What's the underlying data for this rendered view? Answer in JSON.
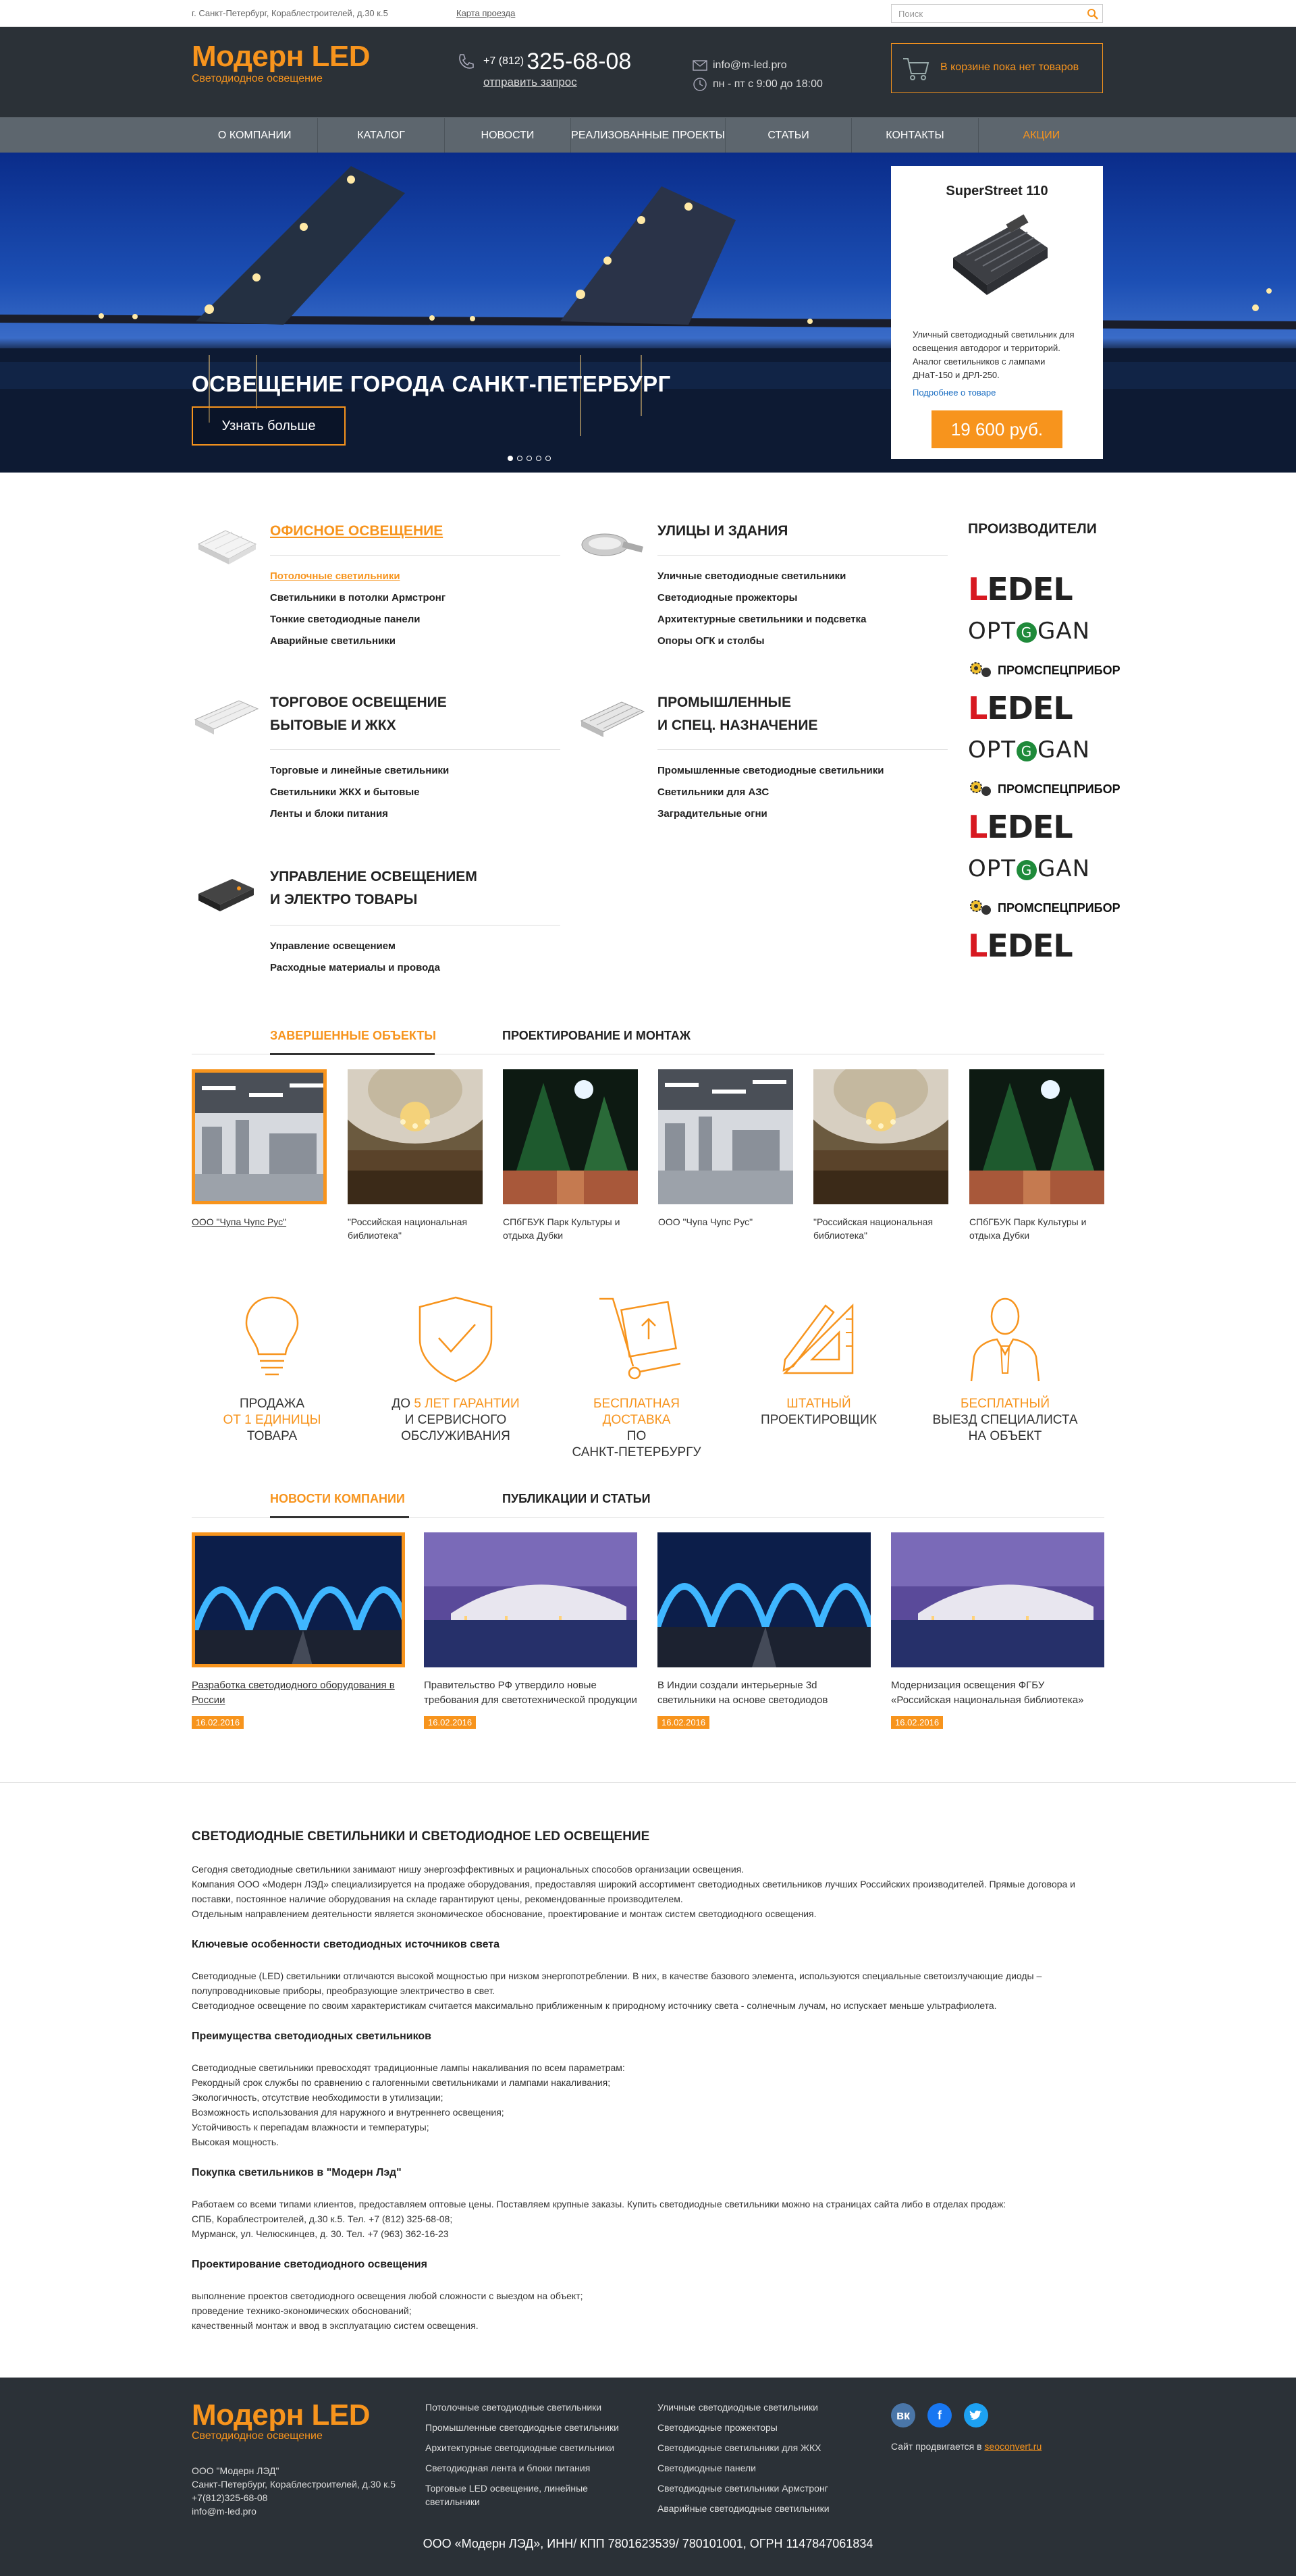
{
  "topbar": {
    "address": "г. Санкт-Петербург, Кораблестроителей, д.30 к.5",
    "map_link": "Карта проезда",
    "search_placeholder": "Поиск"
  },
  "brand": {
    "name": "Модерн LED",
    "tagline": "Светодиодное освещение"
  },
  "header": {
    "phone_code": "+7 (812)",
    "phone_number": "325-68-08",
    "request_link": "отправить запрос",
    "email": "info@m-led.pro",
    "hours": "пн - пт с 9:00 до 18:00",
    "cart_text": "В корзине пока нет товаров"
  },
  "nav": [
    "О КОМПАНИИ",
    "КАТАЛОГ",
    "НОВОСТИ",
    "РЕАЛИЗОВАННЫЕ ПРОЕКТЫ",
    "СТАТЬИ",
    "КОНТАКТЫ",
    "АКЦИИ"
  ],
  "hero": {
    "title": "ОСВЕЩЕНИЕ ГОРОДА САНКТ-ПЕТЕРБУРГ",
    "button": "Узнать больше",
    "slides": 5,
    "active_slide": 1
  },
  "promo": {
    "title": "SuperStreet 110",
    "description": "Уличный светодиодный светильник для освещения автодорог и территорий. Аналог светильников с лампами ДНаТ-150 и ДРЛ-250.",
    "more": "Подробнее о товаре",
    "price": "19 600 руб."
  },
  "categories": [
    {
      "title": [
        "ОФИСНОЕ ОСВЕЩЕНИЕ"
      ],
      "links": [
        "Потолочные светильники",
        "Светильники в потолки Армстронг",
        "Тонкие светодиодные панели",
        "Аварийные светильники"
      ]
    },
    {
      "title": [
        "УЛИЦЫ И ЗДАНИЯ"
      ],
      "links": [
        "Уличные светодиодные светильники",
        "Светодиодные прожекторы",
        "Архитектурные светильники и подсветка",
        "Опоры ОГК и столбы"
      ]
    },
    {
      "title": [
        "ТОРГОВОЕ ОСВЕЩЕНИЕ",
        "БЫТОВЫЕ И ЖКХ"
      ],
      "links": [
        "Торговые и линейные светильники",
        "Светильники ЖКХ и бытовые",
        "Ленты и блоки питания"
      ]
    },
    {
      "title": [
        "ПРОМЫШЛЕННЫЕ",
        "И СПЕЦ. НАЗНАЧЕНИЕ"
      ],
      "links": [
        "Промышленные светодиодные светильники",
        "Светильники для АЗС",
        "Заградительные огни"
      ]
    },
    {
      "title": [
        "УПРАВЛЕНИЕ ОСВЕЩЕНИЕМ",
        "И ЭЛЕКТРО ТОВАРЫ"
      ],
      "links": [
        "Управление освещением",
        "Расходные материалы и провода"
      ]
    }
  ],
  "producers": {
    "title": "ПРОИЗВОДИТЕЛИ",
    "ledel": [
      "L",
      "EDEL"
    ],
    "optogan": [
      "OPT",
      "G",
      "GAN"
    ],
    "promspec": "ПРОМСПЕЦПРИБОР"
  },
  "objects_tabs": [
    "ЗАВЕРШЕННЫЕ ОБЪЕКТЫ",
    "ПРОЕКТИРОВАНИЕ И МОНТАЖ"
  ],
  "objects": [
    "ООО \"Чупа Чупс Рус\"",
    "\"Российская национальная библиотека\"",
    "СПбГБУК Парк Культуры и отдыха Дубки",
    "ООО \"Чупа Чупс Рус\"",
    "\"Российская национальная библиотека\"",
    "СПбГБУК Парк Культуры и отдыха Дубки"
  ],
  "features": [
    {
      "l1": "ПРОДАЖА",
      "l2": "ОТ 1 ЕДИНИЦЫ",
      "l3": "ТОВАРА",
      "l4": ""
    },
    {
      "l1": "ДО",
      "l1o": "5 ЛЕТ ГАРАНТИИ",
      "l2": "И СЕРВИСНОГО",
      "l3": "ОБСЛУЖИВАНИЯ",
      "l4": ""
    },
    {
      "l1": "БЕСПЛАТНАЯ ДОСТАВКА",
      "l2": "ПО",
      "l3": "САНКТ-ПЕТЕРБУРГУ",
      "l4": ""
    },
    {
      "l1": "ШТАТНЫЙ",
      "l2": "ПРОЕКТИРОВЩИК",
      "l3": "",
      "l4": ""
    },
    {
      "l1": "БЕСПЛАТНЫЙ",
      "l2": "ВЫЕЗД СПЕЦИАЛИСТА",
      "l3": "НА ОБЪЕКТ",
      "l4": ""
    }
  ],
  "news_tabs": [
    "НОВОСТИ КОМПАНИИ",
    "ПУБЛИКАЦИИ И СТАТЬИ"
  ],
  "news": [
    {
      "text": "Разработка светодиодного оборудования в России",
      "date": "16.02.2016"
    },
    {
      "text": "Правительство РФ утвердило новые требования для светотехнической продукции",
      "date": "16.02.2016"
    },
    {
      "text": "В Индии создали интерьерные 3d светильники на основе светодиодов",
      "date": "16.02.2016"
    },
    {
      "text": "Модернизация освещения ФГБУ «Российская национальная библиотека»",
      "date": "16.02.2016"
    }
  ],
  "seo": {
    "title": "СВЕТОДИОДНЫЕ СВЕТИЛЬНИКИ И СВЕТОДИОДНОЕ LED ОСВЕЩЕНИЕ",
    "p1": [
      "Сегодня светодиодные светильники занимают нишу энергоэффективных и рациональных способов организации освещения.",
      "Компания ООО «Модерн ЛЭД» специализируется на продаже оборудования, предоставляя широкий ассортимент светодиодных светильников лучших Российских производителей. Прямые договора и",
      "поставки, постоянное наличие оборудования на складе гарантируют цены, рекомендованные производителем.",
      "Отдельным направлением деятельности является экономическое обоснование, проектирование и монтаж систем светодиодного освещения."
    ],
    "h2": "Ключевые особенности светодиодных источников света",
    "p2": [
      "Светодиодные (LED) светильники отличаются высокой мощностью при низком энергопотреблении. В них, в качестве базового элемента, используются специальные светоизлучающие диоды –",
      "полупроводниковые приборы, преобразующие электричество в свет.",
      "Светодиодное освещение по своим характеристикам считается максимально приближенным к природному источнику света - солнечным лучам, но испускает меньше ультрафиолета."
    ],
    "h3": "Преимущества светодиодных светильников",
    "p3": [
      "Светодиодные светильники превосходят традиционные лампы накаливания по всем параметрам:",
      "Рекордный срок службы по сравнению с галогенными светильниками и лампами накаливания;",
      "Экологичность, отсутствие необходимости в утилизации;",
      "Возможность использования для наружного и внутреннего освещения;",
      "Устойчивость к перепадам влажности и температуры;",
      "Высокая мощность."
    ],
    "h4": "Покупка светильников в \"Модерн Лэд\"",
    "p4": [
      "Работаем со всеми типами клиентов, предоставляем оптовые цены. Поставляем крупные заказы. Купить светодиодные светильники можно на страницах сайта либо в отделах продаж:",
      "СПБ, Кораблестроителей, д.30 к.5. Тел. +7 (812) 325-68-08;",
      "Мурманск, ул. Челюскинцев, д. 30. Тел. +7 (963) 362-16-23"
    ],
    "h5": "Проектирование светодиодного освещения",
    "p5": [
      "выполнение проектов светодиодного освещения любой сложности с выездом на объект;",
      "проведение технико-экономических обоснований;",
      "качественный монтаж и ввод в эксплуатацию систем освещения."
    ]
  },
  "footer": {
    "address": [
      "ООО \"Модерн ЛЭД\"",
      "Санкт-Петербург, Кораблестроителей, д.30 к.5",
      "+7(812)325-68-08",
      "info@m-led.pro"
    ],
    "col1": [
      "Потолочные светодиодные светильники",
      "Промышленные светодиодные светильники",
      "Архитектурные светодиодные светильники",
      "Светодиодная лента и блоки питания",
      "Торговые LED освещение, линейные светильники"
    ],
    "col2": [
      "Уличные светодиодные светильники",
      "Светодиодные прожекторы",
      "Светодиодные светильники для ЖКХ",
      "Светодиодные панели",
      "Светодиодные светильники Армстронг",
      "Аварийные светодиодные светильники"
    ],
    "dev_text": "Сайт продвигается в",
    "dev_link": "seoconvert.ru",
    "legal": "ООО «Модерн ЛЭД», ИНН/ КПП 7801623539/ 780101001, ОГРН 1147847061834",
    "social": [
      "vk-icon",
      "facebook-icon",
      "twitter-icon"
    ]
  },
  "colors": {
    "accent": "#f7941d",
    "dark": "#2b3137",
    "nav": "#5d666e",
    "link": "#1b6ec2"
  }
}
